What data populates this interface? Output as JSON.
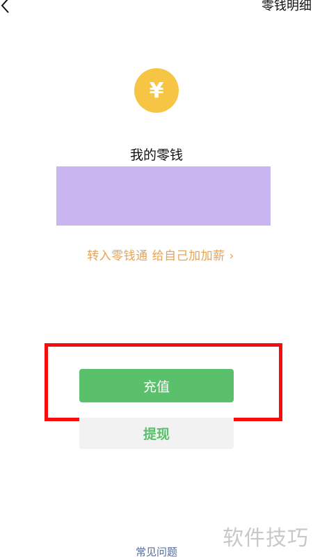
{
  "header": {
    "back_icon": "chevron-left-icon",
    "right_link": "零钱明细"
  },
  "wallet": {
    "coin_symbol": "¥",
    "coin_icon": "yen-coin-icon",
    "title": "我的零钱",
    "promo_text": "转入零钱通 给自己加加薪 ›"
  },
  "actions": {
    "recharge_label": "充值",
    "withdraw_label": "提现"
  },
  "footer": {
    "faq_link": "常见问题",
    "watermark": "软件技巧"
  },
  "colors": {
    "coin": "#f6c544",
    "redact": "#c9b6f0",
    "promo": "#e9a352",
    "highlight": "#f50c0c",
    "green": "#5ac06b"
  }
}
